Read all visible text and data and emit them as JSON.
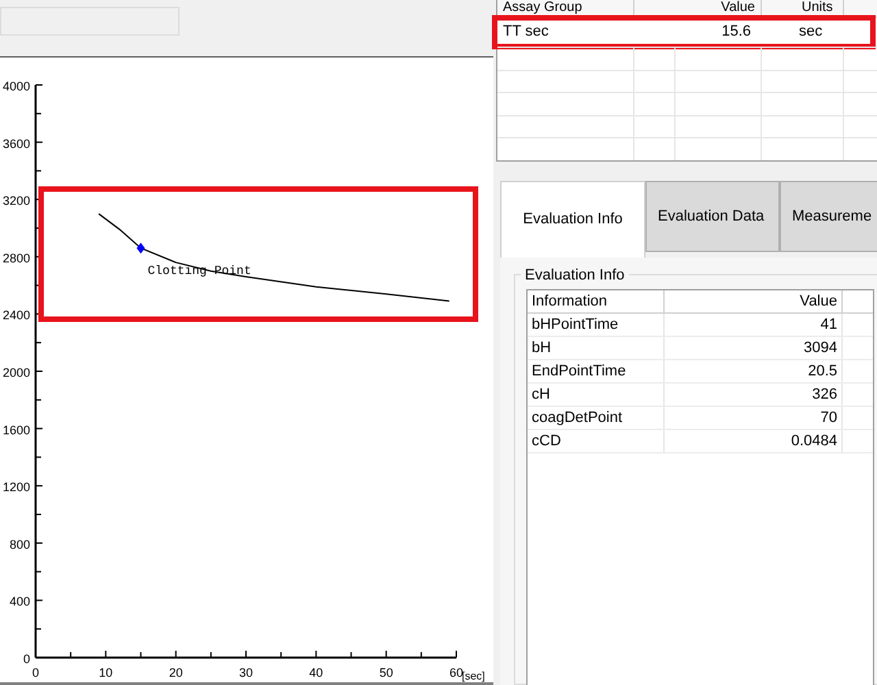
{
  "chart_panel": {
    "chart_data": {
      "type": "line",
      "xlabel": "[sec]",
      "x": [
        9,
        12,
        15,
        20,
        25,
        30,
        40,
        50,
        59
      ],
      "series": [
        {
          "color": "#000000",
          "values": [
            3100,
            2990,
            2860,
            2760,
            2700,
            2660,
            2590,
            2540,
            2490
          ]
        }
      ],
      "xlim": [
        0,
        60
      ],
      "ylim": [
        0,
        4000
      ],
      "xticks": [
        0,
        10,
        20,
        30,
        40,
        50,
        60
      ],
      "yticks": [
        0,
        400,
        800,
        1200,
        1600,
        2000,
        2400,
        2800,
        3200,
        3600,
        4000
      ],
      "annotations": [
        {
          "x": 15,
          "y": 2860,
          "text": "Clotting Point"
        }
      ]
    },
    "highlight": true
  },
  "assay_table": {
    "columns": [
      "Assay Group",
      "Value",
      "Units"
    ],
    "rows": [
      {
        "cells": [
          "TT sec",
          "15.6",
          "sec"
        ],
        "highlighted": true
      }
    ]
  },
  "tabs": [
    {
      "label": "Evaluation Info",
      "selected": true
    },
    {
      "label": "Evaluation Data",
      "selected": false
    },
    {
      "label": "Measureme",
      "selected": false
    }
  ],
  "evaluation_info": {
    "title": "Evaluation Info",
    "columns": [
      "Information",
      "Value"
    ],
    "rows": [
      [
        "bHPointTime",
        "41"
      ],
      [
        "bH",
        "3094"
      ],
      [
        "EndPointTime",
        "20.5"
      ],
      [
        "cH",
        "326"
      ],
      [
        "coagDetPoint",
        "70"
      ],
      [
        "cCD",
        "0.0484"
      ]
    ]
  }
}
